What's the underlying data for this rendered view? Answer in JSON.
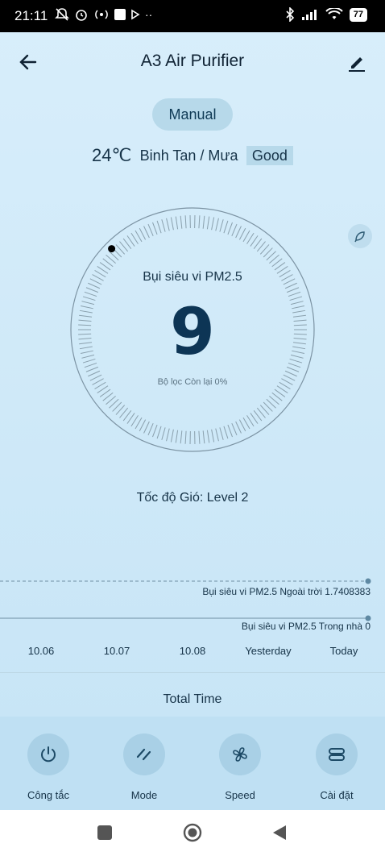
{
  "status_bar": {
    "time": "21:11",
    "battery": "77"
  },
  "header": {
    "title": "A3 Air Purifier"
  },
  "mode": {
    "label": "Manual"
  },
  "weather": {
    "temperature": "24℃",
    "location": "Binh Tan / Mưa",
    "quality": "Good"
  },
  "dial": {
    "label": "Bụi siêu vi PM2.5",
    "value": "9",
    "filter": "Bộ lọc Còn lại 0%"
  },
  "wind": {
    "label": "Tốc độ Gió: Level 2"
  },
  "trend": {
    "outdoor_label": "Bụi siêu vi PM2.5 Ngoài trời 1.7408383",
    "indoor_label": "Bụi siêu vi PM2.5 Trong nhà 0",
    "dates": [
      "10.06",
      "10.07",
      "10.08",
      "Yesterday",
      "Today"
    ]
  },
  "total_time": {
    "label": "Total Time"
  },
  "controls": [
    {
      "label": "Công tắc",
      "icon": "power-icon"
    },
    {
      "label": "Mode",
      "icon": "mode-icon"
    },
    {
      "label": "Speed",
      "icon": "fan-icon"
    },
    {
      "label": "Cài đặt",
      "icon": "settings-icon"
    }
  ],
  "colors": {
    "accent": "#0d3555",
    "background": "#d3ebf9",
    "pill": "#b7d9ea",
    "control_bar": "#bfe0f3"
  }
}
